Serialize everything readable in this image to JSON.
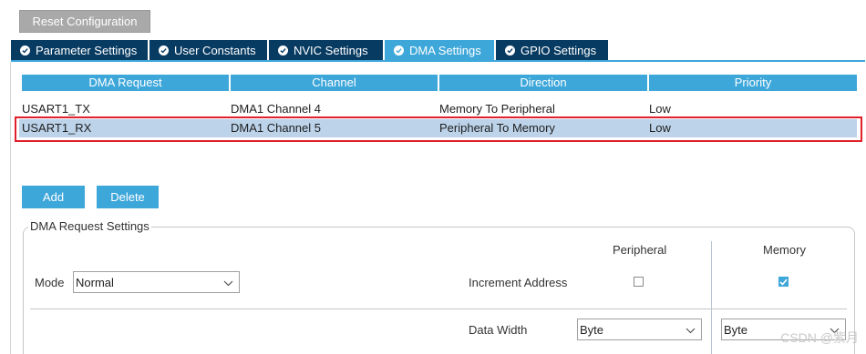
{
  "toolbar": {
    "reset_label": "Reset Configuration"
  },
  "tabs": [
    {
      "label": "Parameter Settings",
      "active": false
    },
    {
      "label": "User Constants",
      "active": false
    },
    {
      "label": "NVIC Settings",
      "active": false
    },
    {
      "label": "DMA Settings",
      "active": true
    },
    {
      "label": "GPIO Settings",
      "active": false
    }
  ],
  "table": {
    "headers": [
      "DMA Request",
      "Channel",
      "Direction",
      "Priority"
    ],
    "rows": [
      {
        "request": "USART1_TX",
        "channel": "DMA1 Channel 4",
        "direction": "Memory To Peripheral",
        "priority": "Low",
        "selected": false
      },
      {
        "request": "USART1_RX",
        "channel": "DMA1 Channel 5",
        "direction": "Peripheral To Memory",
        "priority": "Low",
        "selected": true
      }
    ]
  },
  "actions": {
    "add_label": "Add",
    "delete_label": "Delete"
  },
  "settings": {
    "title": "DMA Request Settings",
    "mode_label": "Mode",
    "mode_value": "Normal",
    "col_peripheral": "Peripheral",
    "col_memory": "Memory",
    "increment_label": "Increment Address",
    "increment_peripheral": false,
    "increment_memory": true,
    "data_width_label": "Data Width",
    "data_width_peripheral": "Byte",
    "data_width_memory": "Byte"
  },
  "watermark": "CSDN @紫月",
  "colors": {
    "accent": "#3ea7da",
    "tab_dark": "#083b62",
    "selection": "#bcd3ea",
    "highlight": "#e0202a"
  }
}
